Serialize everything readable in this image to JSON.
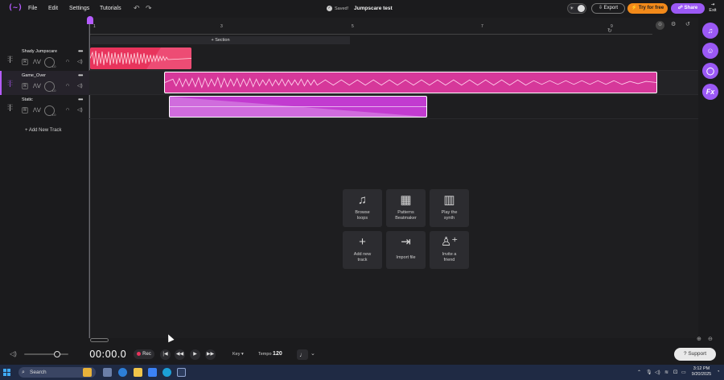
{
  "app": {
    "logo_text": "(~)",
    "project_title": "Jumpscare test",
    "saved_label": "Saved!"
  },
  "menu": {
    "file": "File",
    "edit": "Edit",
    "settings": "Settings",
    "tutorials": "Tutorials"
  },
  "header_buttons": {
    "export": "Export",
    "try_free": "Try for free",
    "share": "Share",
    "exit": "Exit"
  },
  "tracks": [
    {
      "name": "Shady Jumpscare",
      "record_label": "R",
      "knob_value": "L0",
      "color": "#e8345c",
      "selected": false
    },
    {
      "name": "Game_Over",
      "record_label": "R",
      "knob_value": "L0",
      "color": "#d6389a",
      "selected": true
    },
    {
      "name": "Static",
      "record_label": "R",
      "knob_value": "L0",
      "color": "#c23bd0",
      "selected": false
    }
  ],
  "add_track_label": "Add New Track",
  "timeline": {
    "ruler_numbers": [
      "1",
      "3",
      "5",
      "7",
      "9"
    ],
    "section_label": "Section"
  },
  "quick_actions": [
    {
      "label_1": "Browse",
      "label_2": "loops",
      "icon": "music-note-icon"
    },
    {
      "label_1": "Patterns",
      "label_2": "Beatmaker",
      "icon": "patterns-grid-icon"
    },
    {
      "label_1": "Play the",
      "label_2": "synth",
      "icon": "piano-keys-icon"
    },
    {
      "label_1": "Add new",
      "label_2": "track",
      "icon": "plus-icon"
    },
    {
      "label_1": "Import file",
      "label_2": "",
      "icon": "import-icon"
    },
    {
      "label_1": "Invite a",
      "label_2": "friend",
      "icon": "invite-user-icon"
    }
  ],
  "right_toolbar": {
    "fx_label": "Fx"
  },
  "transport": {
    "time": "00:00.0",
    "rec_label": "Rec",
    "key_label": "Key",
    "tempo_label": "Tempo",
    "tempo_value": "120",
    "support_label": "Support"
  },
  "taskbar": {
    "search_label": "Search",
    "time": "3:12 PM",
    "date": "9/20/2025"
  },
  "colors": {
    "accent": "#b55cff",
    "try_button": "#f28a1a",
    "share_button": "#9b59f5"
  }
}
